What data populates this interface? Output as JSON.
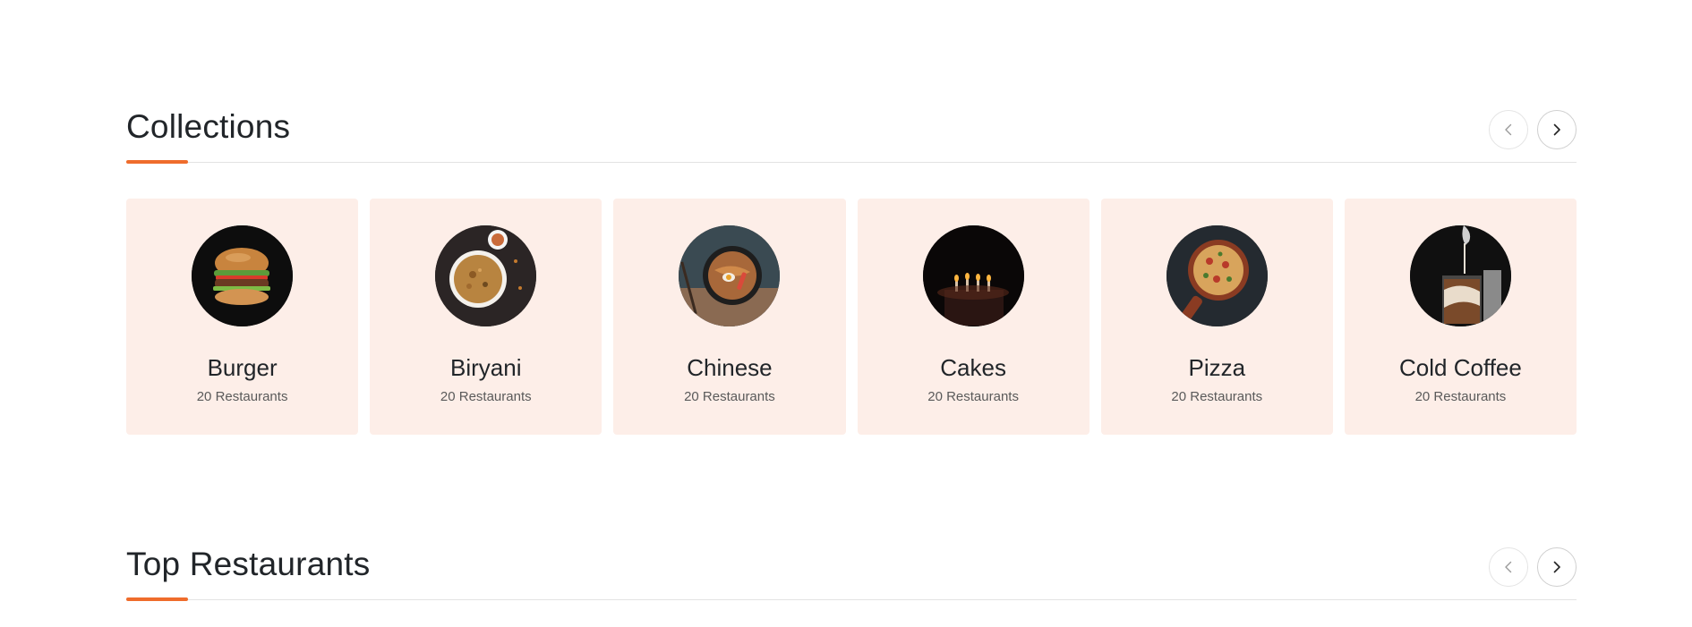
{
  "collections": {
    "title": "Collections",
    "prev_icon": "chevron-left-icon",
    "next_icon": "chevron-right-icon",
    "items": [
      {
        "name": "Burger",
        "count": "20 Restaurants",
        "image": "burger-image"
      },
      {
        "name": "Biryani",
        "count": "20 Restaurants",
        "image": "biryani-image"
      },
      {
        "name": "Chinese",
        "count": "20 Restaurants",
        "image": "chinese-noodles-image"
      },
      {
        "name": "Cakes",
        "count": "20 Restaurants",
        "image": "cake-candles-image"
      },
      {
        "name": "Pizza",
        "count": "20 Restaurants",
        "image": "pizza-image"
      },
      {
        "name": "Cold Coffee",
        "count": "20 Restaurants",
        "image": "cold-coffee-image"
      }
    ]
  },
  "top_restaurants": {
    "title": "Top Restaurants",
    "prev_icon": "chevron-left-icon",
    "next_icon": "chevron-right-icon"
  },
  "colors": {
    "accent": "#ef6c2c",
    "card_background": "#fdeee8",
    "text": "#212529",
    "muted_text": "#5a5a5a"
  }
}
